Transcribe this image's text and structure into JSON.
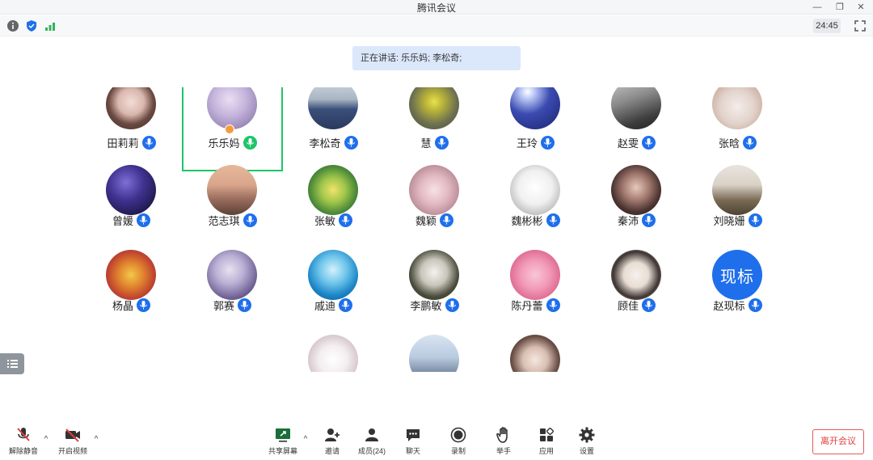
{
  "window": {
    "title": "腾讯会议"
  },
  "status": {
    "timer": "24:45"
  },
  "speaking": {
    "text": "正在讲话: 乐乐妈; 李松奇;"
  },
  "participants": [
    {
      "name": "田莉莉",
      "mic": "blue"
    },
    {
      "name": "乐乐妈",
      "mic": "green"
    },
    {
      "name": "李松奇",
      "mic": "blue"
    },
    {
      "name": "慧",
      "mic": "blue"
    },
    {
      "name": "王玲",
      "mic": "blue"
    },
    {
      "name": "赵雯",
      "mic": "blue"
    },
    {
      "name": "张晗",
      "mic": "blue"
    },
    {
      "name": "曾媛",
      "mic": "blue"
    },
    {
      "name": "范志琪",
      "mic": "blue"
    },
    {
      "name": "张敏",
      "mic": "blue"
    },
    {
      "name": "魏颖",
      "mic": "blue"
    },
    {
      "name": "魏彬彬",
      "mic": "blue"
    },
    {
      "name": "秦沛",
      "mic": "blue"
    },
    {
      "name": "刘晓姗",
      "mic": "blue"
    },
    {
      "name": "杨晶",
      "mic": "blue"
    },
    {
      "name": "郭赛",
      "mic": "blue"
    },
    {
      "name": "戚迪",
      "mic": "blue"
    },
    {
      "name": "李鹏敏",
      "mic": "blue"
    },
    {
      "name": "陈丹蕾",
      "mic": "blue"
    },
    {
      "name": "顾佳",
      "mic": "blue"
    },
    {
      "name": "赵现标",
      "mic": "blue",
      "avatar_text": "现标"
    }
  ],
  "toolbar": {
    "unmute": "解除静音",
    "start_video": "开启视频",
    "share_screen": "共享屏幕",
    "invite": "邀请",
    "members": "成员(24)",
    "chat": "聊天",
    "record": "录制",
    "raise_hand": "举手",
    "apps": "应用",
    "settings": "设置",
    "leave": "离开会议"
  },
  "colors": {
    "accent": "#1f6fec",
    "speaking": "#1fc46a",
    "leave": "#e03e3e"
  }
}
